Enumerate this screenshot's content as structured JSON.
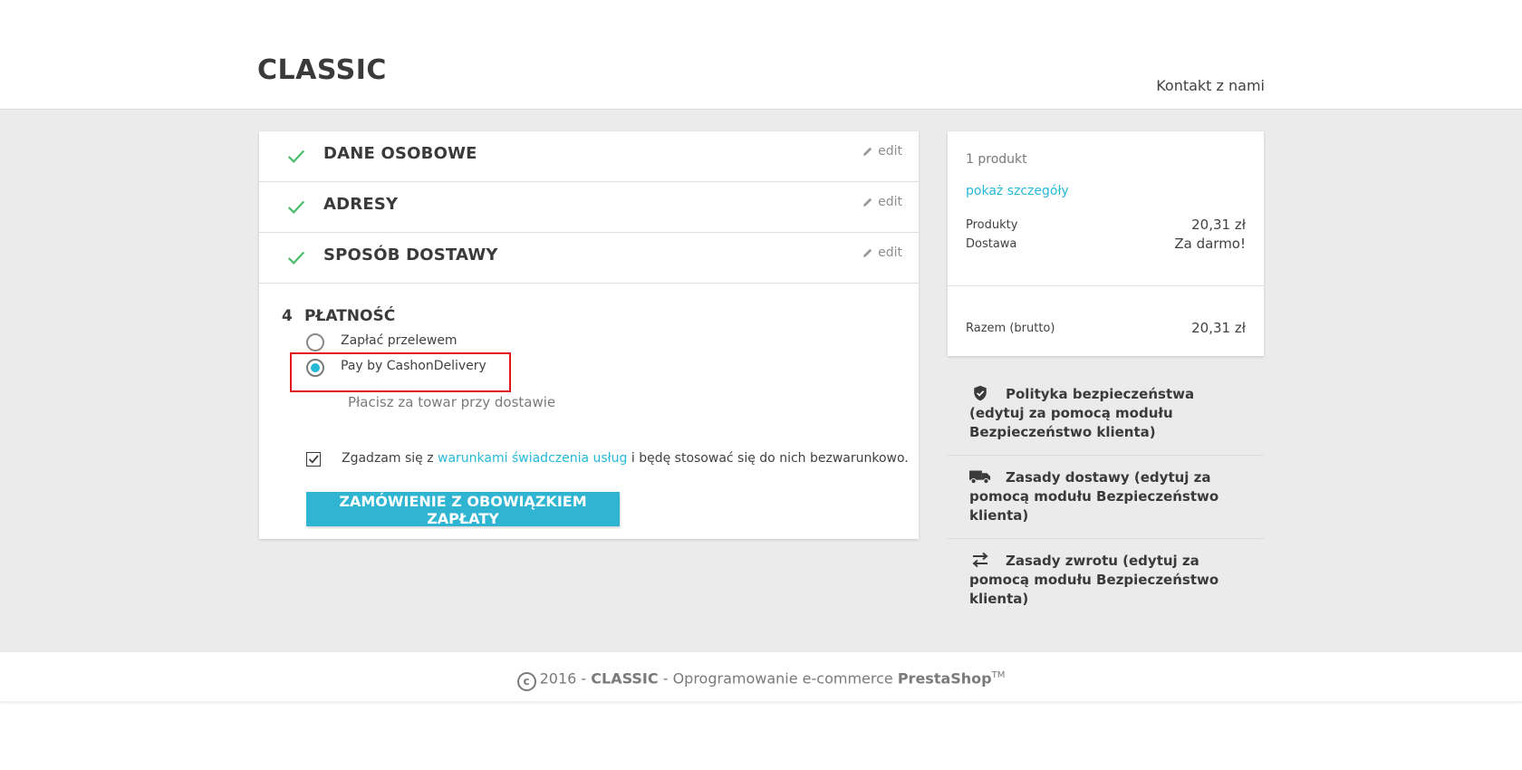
{
  "header": {
    "logo": "CLASSIC",
    "contact_link": "Kontakt z nami"
  },
  "steps": [
    {
      "title": "DANE OSOBOWE",
      "edit_label": "edit"
    },
    {
      "title": "ADRESY",
      "edit_label": "edit"
    },
    {
      "title": "SPOSÓB DOSTAWY",
      "edit_label": "edit"
    }
  ],
  "payment": {
    "step_number": "4",
    "title": "PŁATNOŚĆ",
    "options": [
      {
        "label": "Zapłać przelewem",
        "selected": false
      },
      {
        "label": "Pay by CashonDelivery",
        "selected": true
      }
    ],
    "selected_description": "Płacisz za towar przy dostawie",
    "terms": {
      "checked": true,
      "prefix": "Zgadzam się z ",
      "link_text": "warunkami świadczenia usług",
      "suffix": " i będę stosować się do nich bezwarunkowo."
    },
    "order_button": "ZAMÓWIENIE Z OBOWIĄZKIEM ZAPŁATY"
  },
  "summary": {
    "count": "1 produkt",
    "details_link": "pokaż szczegóły",
    "products_label": "Produkty",
    "products_value": "20,31 zł",
    "shipping_label": "Dostawa",
    "shipping_value": "Za darmo!",
    "total_label": "Razem (brutto)",
    "total_value": "20,31 zł"
  },
  "reassurance": [
    {
      "icon": "shield-icon",
      "text": "Polityka bezpieczeństwa (edytuj za pomocą modułu Bezpieczeństwo klienta)"
    },
    {
      "icon": "truck-icon",
      "text": "Zasady dostawy (edytuj za pomocą modułu Bezpieczeństwo klienta)"
    },
    {
      "icon": "swap-arrows-icon",
      "text": "Zasady zwrotu (edytuj za pomocą modułu Bezpieczeństwo klienta)"
    }
  ],
  "footer": {
    "year": "2016",
    "sep1": " - ",
    "shop": "CLASSIC",
    "middle": " - Oprogramowanie e-commerce ",
    "brand": "PrestaShop",
    "tm": "TM"
  },
  "colors": {
    "accent": "#2fb5d2",
    "check": "#4cbb6c",
    "highlight": "#e0141c",
    "background": "#ebebeb"
  }
}
